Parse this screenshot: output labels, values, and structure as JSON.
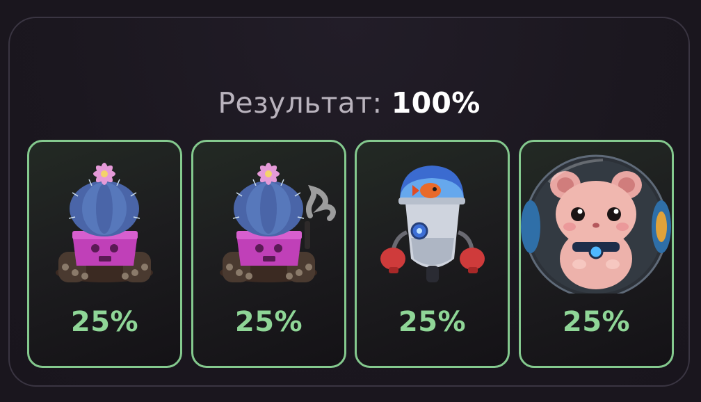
{
  "result": {
    "label": "Результат:",
    "value": "100%"
  },
  "cards": [
    {
      "icon": "cactus-tank-icon",
      "percent": "25%"
    },
    {
      "icon": "smoking-cactus-tank-icon",
      "percent": "25%"
    },
    {
      "icon": "boxing-robot-icon",
      "percent": "25%"
    },
    {
      "icon": "hamster-ball-icon",
      "percent": "25%"
    }
  ],
  "colors": {
    "background": "#1a161e",
    "panel_border": "#3a3542",
    "card_border": "#84c98e",
    "percent_text": "#8fd697",
    "title_label": "#b9b3bd",
    "title_value": "#ffffff"
  }
}
